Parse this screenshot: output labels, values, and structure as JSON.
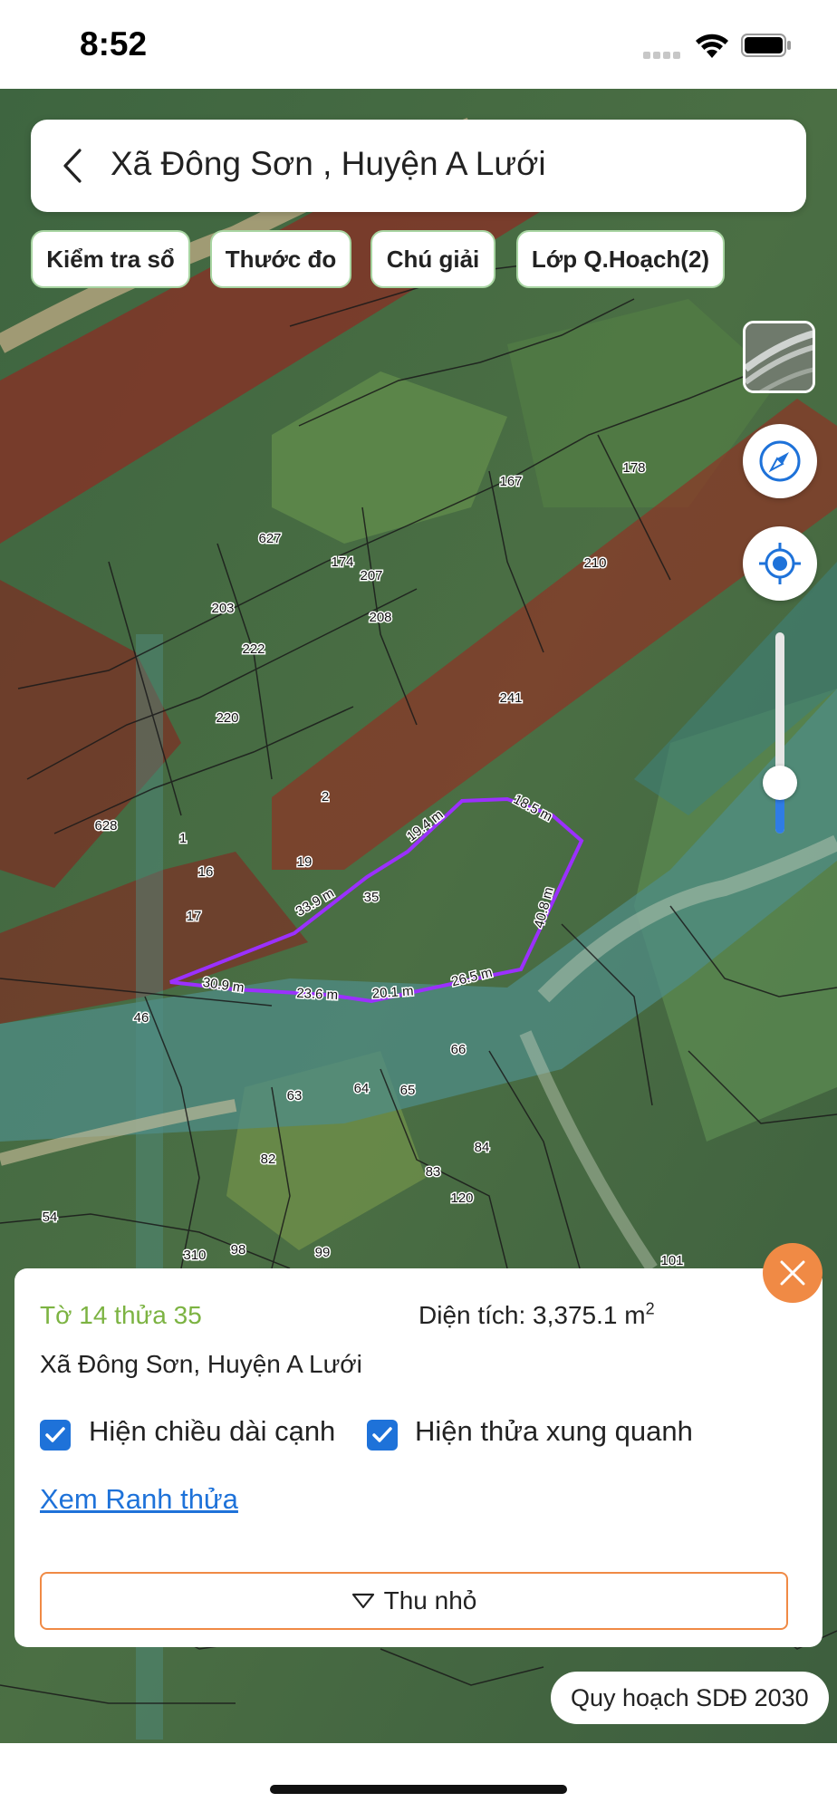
{
  "status_bar": {
    "time": "8:52"
  },
  "header": {
    "title": "Xã Đông Sơn , Huyện A Lưới"
  },
  "chips": [
    "Kiểm tra sổ",
    "Thước đo",
    "Chú giải",
    "Lớp Q.Hoạch(2)"
  ],
  "map": {
    "parcel_labels": [
      "167",
      "178",
      "627",
      "174",
      "207",
      "210",
      "203",
      "208",
      "222",
      "241",
      "220",
      "2",
      "628",
      "1",
      "19",
      "16",
      "35",
      "17",
      "46",
      "66",
      "63",
      "64",
      "65",
      "84",
      "82",
      "83",
      "120",
      "54",
      "310",
      "98",
      "99",
      "101"
    ],
    "edge_lengths": [
      "19.4 m",
      "18.5 m",
      "33.9 m",
      "40.8 m",
      "30.9 m",
      "23.6 m",
      "20.1 m",
      "26.5 m"
    ],
    "highlight_color": "#9b30ff"
  },
  "panel": {
    "parcel_id": "Tờ 14 thửa 35",
    "area_label": "Diện tích: 3,375.1 m",
    "area_unit_exp": "2",
    "address": "Xã Đông Sơn, Huyện A Lưới",
    "checkbox_1": "Hiện chiều dài cạnh",
    "checkbox_2": "Hiện thửa xung quanh",
    "link": "Xem Ranh thửa",
    "collapse": "Thu nhỏ"
  },
  "plan_badge": "Quy hoạch SDĐ 2030",
  "colors": {
    "accent": "#f08a45",
    "link": "#1e72d9",
    "parcel_title": "#7cb342",
    "chip_border": "#a8d5a2"
  }
}
